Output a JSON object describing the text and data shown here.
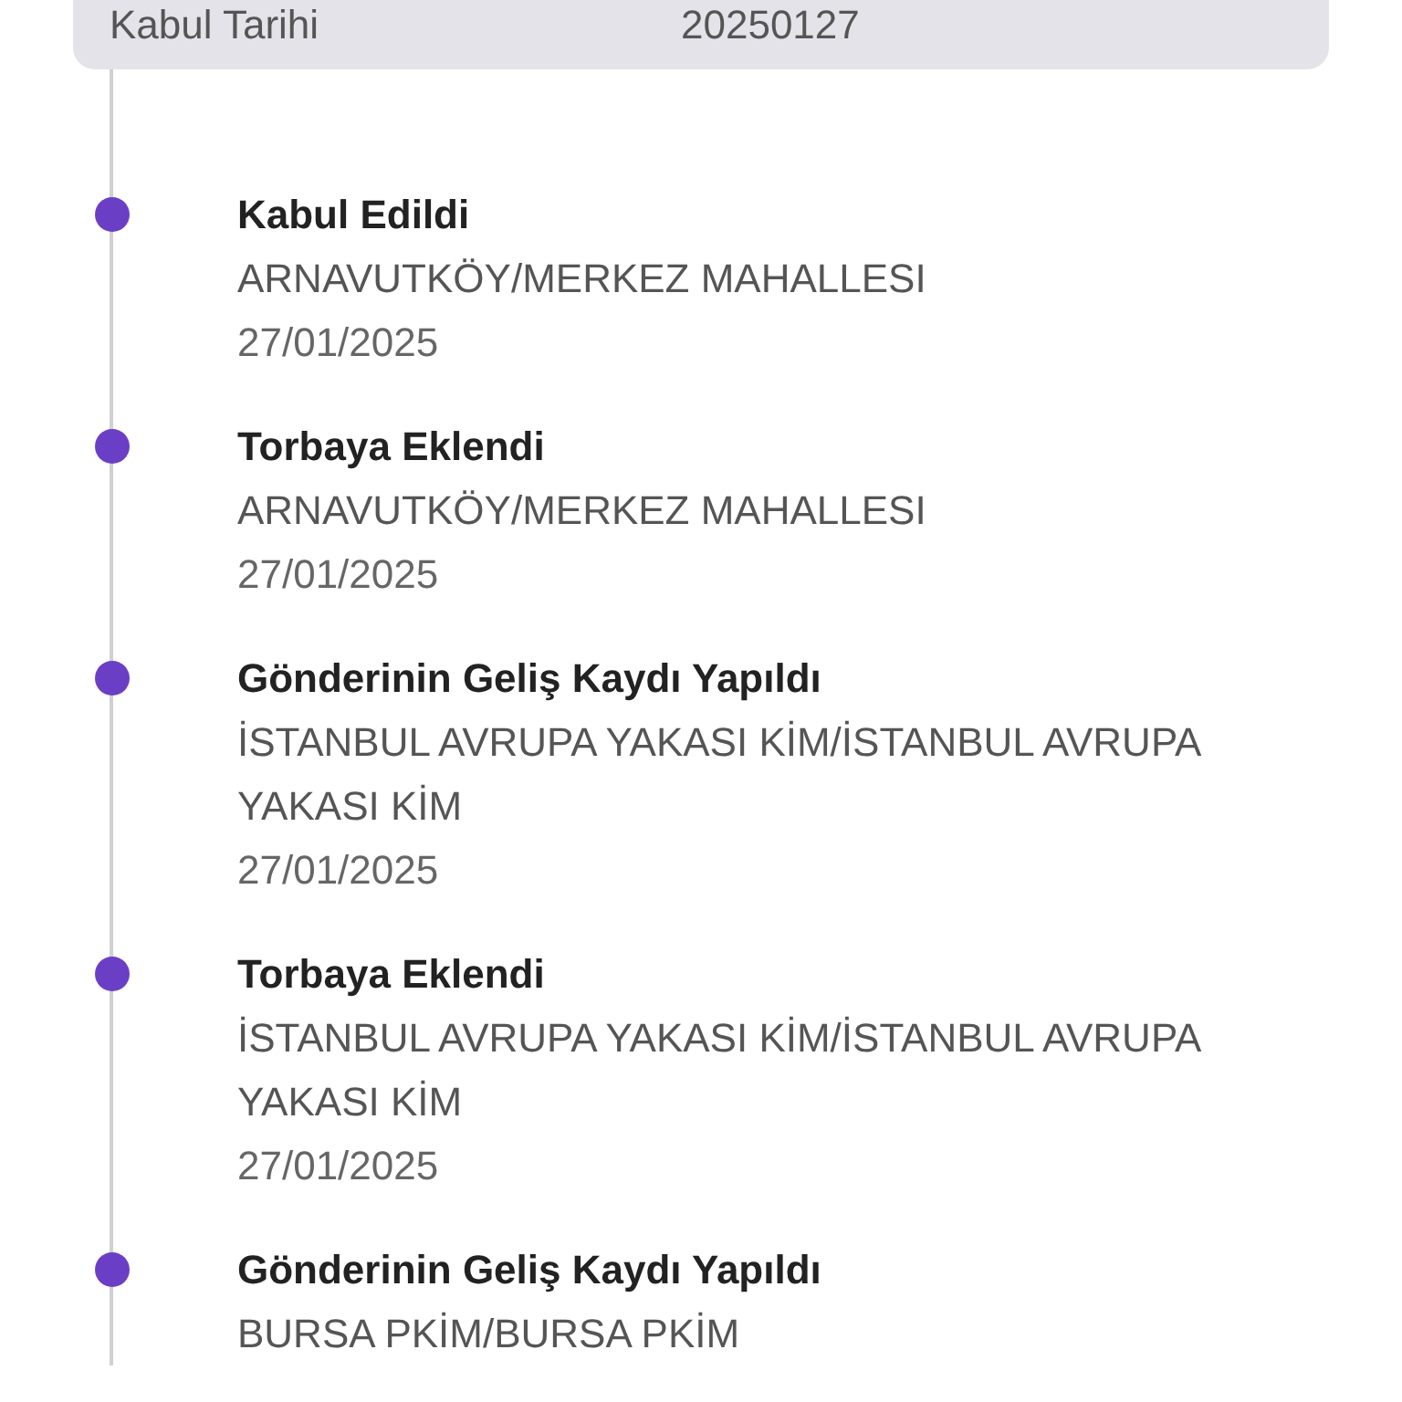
{
  "info_card": {
    "rows": [
      {
        "label": "Kabul Tarihi",
        "value": "20250127"
      }
    ]
  },
  "events": [
    {
      "title": "Kabul Edildi",
      "location": "ARNAVUTKÖY/MERKEZ MAHALLESI",
      "date": "27/01/2025"
    },
    {
      "title": "Torbaya Eklendi",
      "location": "ARNAVUTKÖY/MERKEZ MAHALLESI",
      "date": "27/01/2025"
    },
    {
      "title": "Gönderinin Geliş Kaydı Yapıldı",
      "location": "İSTANBUL AVRUPA YAKASI KİM/İSTANBUL AVRUPA YAKASI KİM",
      "date": "27/01/2025"
    },
    {
      "title": "Torbaya Eklendi",
      "location": "İSTANBUL AVRUPA YAKASI KİM/İSTANBUL AVRUPA YAKASI KİM",
      "date": "27/01/2025"
    },
    {
      "title": "Gönderinin Geliş Kaydı Yapıldı",
      "location": "BURSA PKİM/BURSA PKİM"
    }
  ]
}
